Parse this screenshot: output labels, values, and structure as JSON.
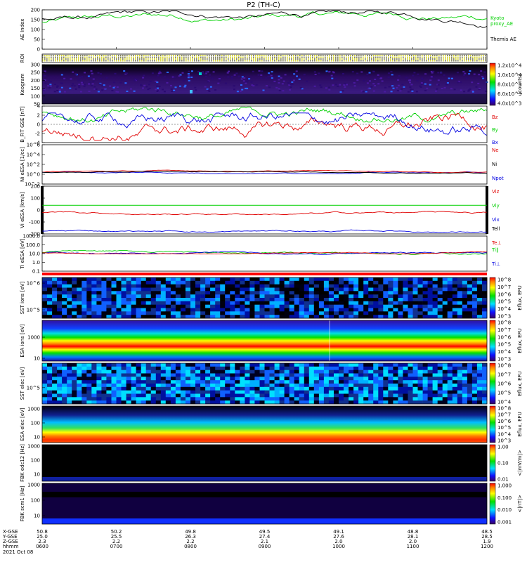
{
  "title": "P2 (TH-C)",
  "date_label": "2021 Oct 08",
  "footer_rows": [
    "X-GSE",
    "Y-GSE",
    "Z-GSE",
    "hhmm"
  ],
  "footer_cols": [
    {
      "x": "50.8",
      "y": "25.0",
      "z": "2.3",
      "t": "0600"
    },
    {
      "x": "50.2",
      "y": "25.5",
      "z": "2.2",
      "t": "0700"
    },
    {
      "x": "49.8",
      "y": "26.3",
      "z": "2.2",
      "t": "0800"
    },
    {
      "x": "49.5",
      "y": "27.4",
      "z": "2.1",
      "t": "0900"
    },
    {
      "x": "49.1",
      "y": "27.6",
      "z": "2.0",
      "t": "1000"
    },
    {
      "x": "48.8",
      "y": "28.1",
      "z": "2.0",
      "t": "1100"
    },
    {
      "x": "48.5",
      "y": "28.5",
      "z": "1.9",
      "t": "1200"
    }
  ],
  "colors": {
    "green": "#00d000",
    "red": "#e00000",
    "blue": "#0000e0",
    "black": "#000000"
  },
  "chart_data": [
    {
      "type": "line",
      "panel": "AE Index",
      "ylabel": "AE Index",
      "yticks": [
        "200",
        "150",
        "100",
        "50",
        "0"
      ],
      "ylim": [
        0,
        220
      ],
      "series": [
        {
          "name": "Kyoto proxy AE",
          "color": "#00d000"
        },
        {
          "name": "Themis AE",
          "color": "#000000"
        }
      ],
      "legend": [
        "Kyoto",
        "proxy_AE",
        "Themis AE"
      ]
    },
    {
      "type": "heatmap",
      "panel": "ROI",
      "ylabel": "ROI"
    },
    {
      "type": "heatmap",
      "panel": "Keogram",
      "ylabel": "Keogram",
      "yticks": [
        "300",
        "250",
        "200",
        "150",
        "100",
        "50"
      ],
      "colorbar": [
        "1.2x10^4",
        "1.0x10^4",
        "8.0x10^3",
        "6.0x10^3",
        "4.0x10^3"
      ],
      "cbar_label": "[counts]"
    },
    {
      "type": "line",
      "panel": "B FIT",
      "ylabel": "B_FIT GSE [nT]",
      "yticks": [
        "4",
        "2",
        "0",
        "-2",
        "-4"
      ],
      "series": [
        {
          "name": "Bz",
          "color": "#e00000"
        },
        {
          "name": "By",
          "color": "#00d000"
        },
        {
          "name": "Bx",
          "color": "#0000e0"
        }
      ]
    },
    {
      "type": "line",
      "panel": "Ni",
      "ylabel": "Ni eESA [1/cc]",
      "yticks": [
        "10^6",
        "10^4",
        "10^2",
        "10^0",
        "10^-2"
      ],
      "series": [
        {
          "name": "Ne",
          "color": "#e00000"
        },
        {
          "name": "Ni",
          "color": "#000000"
        },
        {
          "name": "Npot",
          "color": "#0000e0"
        }
      ]
    },
    {
      "type": "line",
      "panel": "Vi",
      "ylabel": "Vi eESA [km/s]",
      "yticks": [
        "200",
        "100",
        "0",
        "-100",
        "-200"
      ],
      "series": [
        {
          "name": "Viz",
          "color": "#e00000"
        },
        {
          "name": "Viy",
          "color": "#00d000"
        },
        {
          "name": "Vix",
          "color": "#0000e0"
        }
      ]
    },
    {
      "type": "line",
      "panel": "Ti",
      "ylabel": "Ti eESA [eV]",
      "yticks": [
        "1000.0",
        "100.0",
        "10.0",
        "1.0",
        "0.1"
      ],
      "series": [
        {
          "name": "Tell",
          "color": "#000000"
        },
        {
          "name": "Te⊥",
          "color": "#e00000"
        },
        {
          "name": "Ti∥",
          "color": "#00d000"
        },
        {
          "name": "Ti⊥",
          "color": "#0000e0"
        }
      ]
    },
    {
      "type": "heatmap",
      "panel": "SST ions",
      "ylabel": "SST ions [eV]",
      "yticks": [
        "10^6",
        "10^5"
      ],
      "colorbar": [
        "10^8",
        "10^7",
        "10^6",
        "10^5",
        "10^4",
        "10^3"
      ],
      "cbar_label": "Eflux, EFU"
    },
    {
      "type": "heatmap",
      "panel": "ESA ions",
      "ylabel": "ESA ions [eV]",
      "yticks": [
        "1000",
        "10"
      ],
      "colorbar": [
        "10^8",
        "10^7",
        "10^6",
        "10^5",
        "10^4",
        "10^3"
      ],
      "cbar_label": "Eflux, EFU"
    },
    {
      "type": "heatmap",
      "panel": "SST elec",
      "ylabel": "SST elec [eV]",
      "yticks": [
        "10^5"
      ],
      "colorbar": [
        "10^8",
        "10^7",
        "10^6",
        "10^5",
        "10^4"
      ],
      "cbar_label": "Eflux, EFU"
    },
    {
      "type": "heatmap",
      "panel": "ESA elec",
      "ylabel": "ESA elec [eV]",
      "yticks": [
        "1000",
        "100",
        "10"
      ],
      "colorbar": [
        "10^8",
        "10^7",
        "10^6",
        "10^5",
        "10^4",
        "10^3"
      ],
      "cbar_label": "Eflux, EFU"
    },
    {
      "type": "heatmap",
      "panel": "FBK edc12",
      "ylabel": "FBK edc12 [Hz]",
      "yticks": [
        "1000",
        "100",
        "10"
      ],
      "colorbar": [
        "1.00",
        "0.10",
        "0.01"
      ],
      "cbar_label": "<|mV/m|>"
    },
    {
      "type": "heatmap",
      "panel": "FBK scm1",
      "ylabel": "FBK scm1 [Hz]",
      "yticks": [
        "1000",
        "100",
        "10"
      ],
      "colorbar": [
        "1.000",
        "0.100",
        "0.010",
        "0.001"
      ],
      "cbar_label": "<|nT|>"
    }
  ]
}
